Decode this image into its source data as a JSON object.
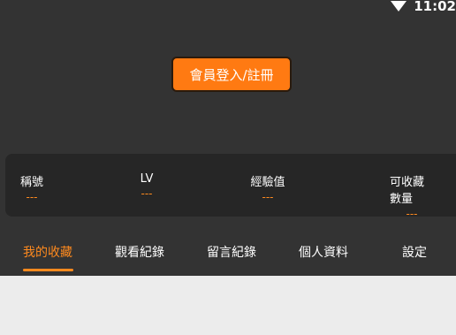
{
  "status_bar": {
    "time": "11:02",
    "wifi_icon": "wifi-icon"
  },
  "login_button": {
    "label": "會員登入/註冊"
  },
  "stats": {
    "title_label": "稱號",
    "title_value": "---",
    "level_label": "LV",
    "level_value": "---",
    "exp_label": "經驗值",
    "exp_value": "---",
    "favorites_label": "可收藏數量",
    "favorites_value": "---"
  },
  "tabs": {
    "favorites": "我的收藏",
    "history": "觀看紀錄",
    "comments": "留言紀錄",
    "profile": "個人資料",
    "settings": "設定",
    "active": "favorites"
  },
  "colors": {
    "accent": "#ff8a1e",
    "button_bg": "#ff7a12",
    "background_dark": "#333333",
    "card_bg": "#262626",
    "content_bg": "#ececec"
  }
}
